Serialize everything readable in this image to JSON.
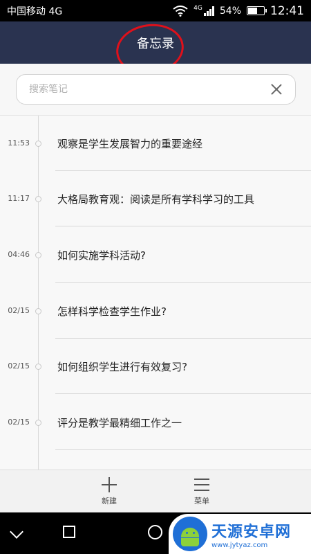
{
  "status_bar": {
    "carrier": "中国移动 4G",
    "network": "4G",
    "battery": "54%",
    "battery_level": 0.54,
    "time": "12:41"
  },
  "header": {
    "title": "备忘录"
  },
  "search": {
    "placeholder": "搜索笔记"
  },
  "notes": [
    {
      "time": "11:53",
      "title": "观察是学生发展智力的重要途经"
    },
    {
      "time": "11:17",
      "title": "大格局教育观：阅读是所有学科学习的工具"
    },
    {
      "time": "04:46",
      "title": "如何实施学科活动?"
    },
    {
      "time": "02/15",
      "title": "怎样科学检查学生作业?"
    },
    {
      "time": "02/15",
      "title": "如何组织学生进行有效复习?"
    },
    {
      "time": "02/15",
      "title": "评分是教学最精细工作之一"
    }
  ],
  "toolbar": {
    "new_label": "新建",
    "menu_label": "菜单"
  },
  "watermark": {
    "title": "天源安卓网",
    "url": "www.jytyaz.com"
  },
  "colors": {
    "header_bg": "#2a3350",
    "annotation_red": "#e0101a",
    "brand_blue": "#1f6fd6"
  },
  "icons": [
    "wifi-icon",
    "signal-icon",
    "battery-icon",
    "close-icon",
    "plus-icon",
    "menu-icon",
    "back-icon",
    "home-icon",
    "recent-icon"
  ]
}
